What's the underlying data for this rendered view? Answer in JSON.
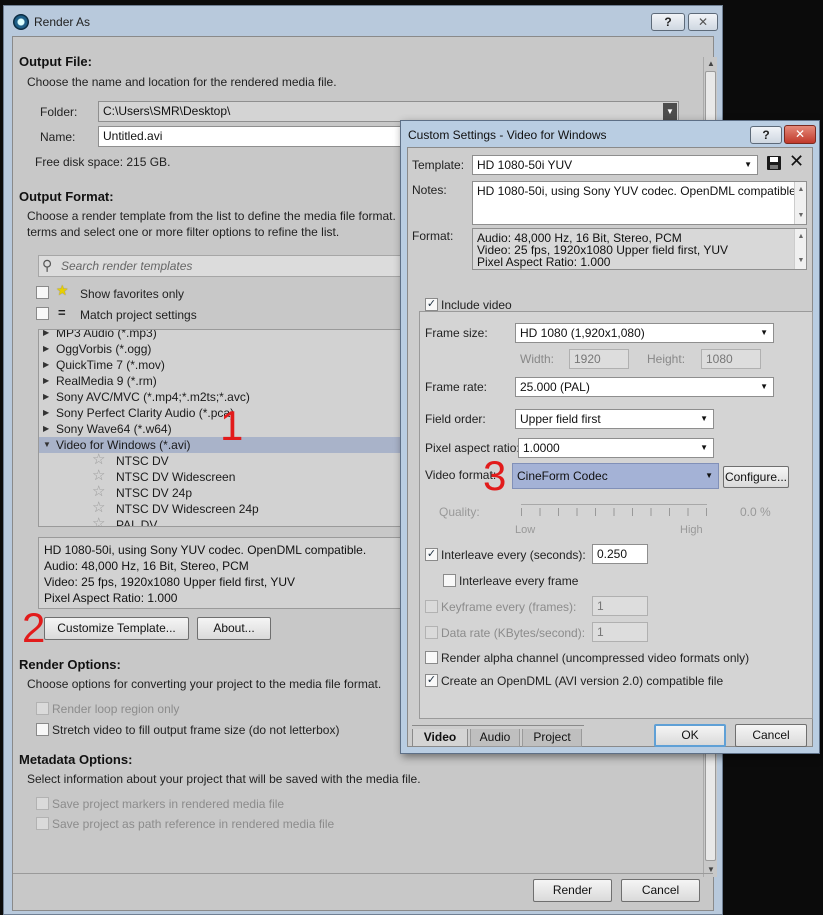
{
  "main": {
    "title": "Render As",
    "help_btn": "?",
    "close_btn": "✕",
    "output_file": {
      "title": "Output File:",
      "desc": "Choose the name and location for the rendered media file.",
      "folder_label": "Folder:",
      "folder_value": "C:\\Users\\SMR\\Desktop\\",
      "name_label": "Name:",
      "name_value": "Untitled.avi",
      "free_space": "Free disk space: 215 GB."
    },
    "output_format": {
      "title": "Output Format:",
      "desc_line1": "Choose a render template from the list to define the media file format.",
      "desc_line2": "terms and select one or more filter options to refine the list.",
      "search_placeholder": "Search render templates",
      "show_favorites": "Show favorites only",
      "match_project": "Match project settings",
      "match_symbol": "="
    },
    "template_list": [
      {
        "label": "MP3 Audio (*.mp3)",
        "indent": 0
      },
      {
        "label": "OggVorbis (*.ogg)",
        "indent": 0
      },
      {
        "label": "QuickTime 7 (*.mov)",
        "indent": 0
      },
      {
        "label": "RealMedia 9 (*.rm)",
        "indent": 0
      },
      {
        "label": "Sony AVC/MVC (*.mp4;*.m2ts;*.avc)",
        "indent": 0
      },
      {
        "label": "Sony Perfect Clarity Audio (*.pca)",
        "indent": 0
      },
      {
        "label": "Sony Wave64 (*.w64)",
        "indent": 0
      },
      {
        "label": "Video for Windows (*.avi)",
        "indent": 0,
        "expanded": true,
        "selected": true
      },
      {
        "label": "NTSC DV",
        "indent": 1
      },
      {
        "label": "NTSC DV Widescreen",
        "indent": 1
      },
      {
        "label": "NTSC DV 24p",
        "indent": 1
      },
      {
        "label": "NTSC DV Widescreen 24p",
        "indent": 1
      },
      {
        "label": "PAL DV",
        "indent": 1
      }
    ],
    "info": [
      "HD 1080-50i, using Sony YUV codec. OpenDML compatible.",
      "Audio: 48,000 Hz, 16 Bit, Stereo, PCM",
      "Video: 25 fps, 1920x1080 Upper field first, YUV",
      "Pixel Aspect Ratio: 1.000"
    ],
    "customize_btn": "Customize Template...",
    "about_btn": "About...",
    "render_options": {
      "title": "Render Options:",
      "desc": "Choose options for converting your project to the media file format.",
      "loop_region": "Render loop region only",
      "stretch": "Stretch video to fill output frame size (do not letterbox)"
    },
    "metadata": {
      "title": "Metadata Options:",
      "desc": "Select information about your project that will be saved with the media file.",
      "markers": "Save project markers in rendered media file",
      "path_ref": "Save project as path reference in rendered media file"
    },
    "render_btn": "Render",
    "cancel_btn": "Cancel"
  },
  "annotations": {
    "a1": "1",
    "a2": "2",
    "a3": "3"
  },
  "dialog": {
    "title": "Custom Settings - Video for Windows",
    "help_btn": "?",
    "close_btn": "✕",
    "template_label": "Template:",
    "template_value": "HD 1080-50i YUV",
    "notes_label": "Notes:",
    "notes_value": "HD 1080-50i, using Sony YUV codec. OpenDML compatible.",
    "format_label": "Format:",
    "format_lines": [
      "Audio: 48,000 Hz, 16 Bit, Stereo, PCM",
      "Video: 25 fps, 1920x1080 Upper field first, YUV",
      "Pixel Aspect Ratio: 1.000"
    ],
    "video": {
      "include_video": "Include video",
      "frame_size_label": "Frame size:",
      "frame_size_value": "HD 1080 (1,920x1,080)",
      "width_label": "Width:",
      "width_value": "1920",
      "height_label": "Height:",
      "height_value": "1080",
      "frame_rate_label": "Frame rate:",
      "frame_rate_value": "25.000 (PAL)",
      "field_order_label": "Field order:",
      "field_order_value": "Upper field first",
      "par_label": "Pixel aspect ratio:",
      "par_value": "1.0000",
      "video_format_label": "Video format:",
      "video_format_value": "CineForm Codec",
      "configure_btn": "Configure...",
      "quality_label": "Quality:",
      "quality_low": "Low",
      "quality_high": "High",
      "quality_value": "0.0 %",
      "interleave_label": "Interleave every (seconds):",
      "interleave_value": "0.250",
      "interleave_frame": "Interleave every frame",
      "keyframe_label": "Keyframe every (frames):",
      "keyframe_value": "1",
      "datarate_label": "Data rate (KBytes/second):",
      "datarate_value": "1",
      "alpha_label": "Render alpha channel (uncompressed video formats only)",
      "opendml_label": "Create an OpenDML (AVI version 2.0) compatible file"
    },
    "tabs": [
      "Video",
      "Audio",
      "Project"
    ],
    "ok_btn": "OK",
    "cancel_btn": "Cancel"
  },
  "icons": {
    "save": "save-icon",
    "close": "close-icon",
    "search": "search-icon",
    "favorite": "star-icon"
  },
  "colors": {
    "annotation": "#e21b1b",
    "selection": "#a9b3c9",
    "highlight": "#a4b2d6"
  }
}
